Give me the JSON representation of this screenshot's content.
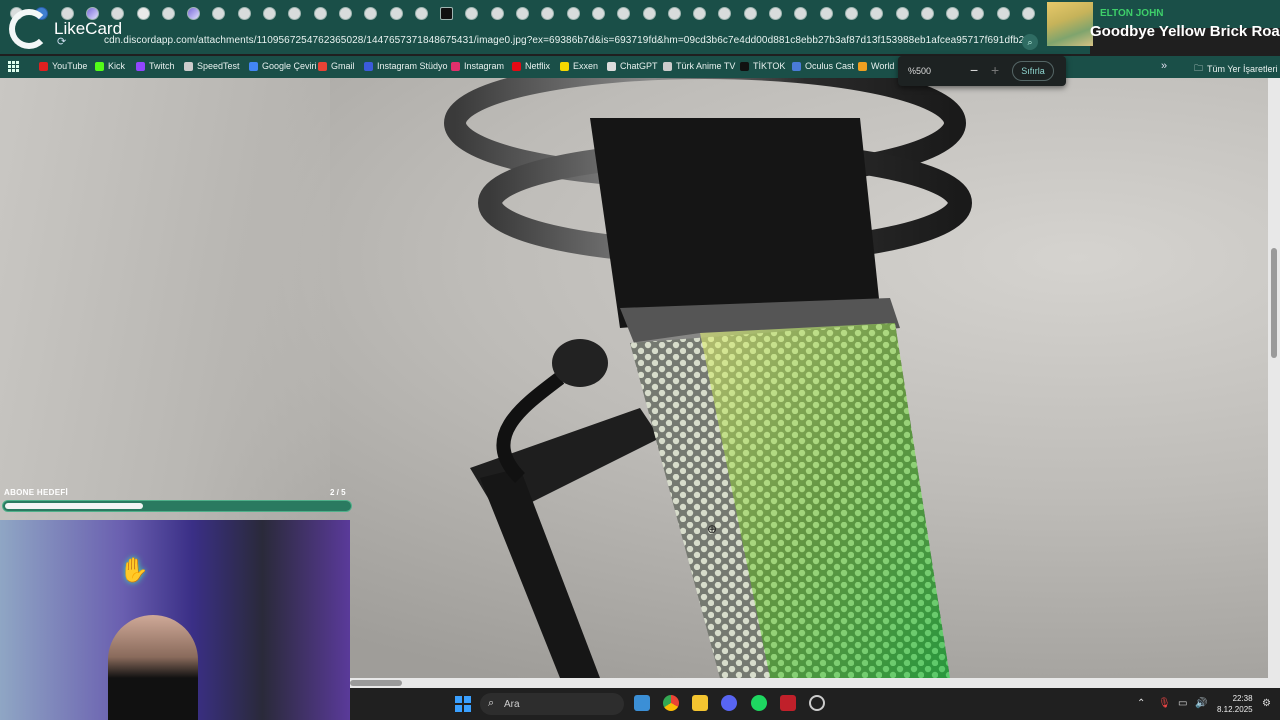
{
  "browser": {
    "url": "cdn.discordapp.com/attachments/1109567254762365028/1447657371848675431/image0.jpg?ex=69386b7d&is=693719fd&hm=09cd3b6c7e4dd00d881c8ebb27b3af87d13f153988eb1afcea95717f691dfb2&",
    "zoom_value": "%500",
    "zoom_reset": "Sıfırla",
    "all_bookmarks": "Tüm Yer İşaretleri",
    "bookmarks": [
      {
        "label": "YouTube",
        "color": "#e02020"
      },
      {
        "label": "Kick",
        "color": "#53fc18"
      },
      {
        "label": "Twitch",
        "color": "#9146ff"
      },
      {
        "label": "SpeedTest",
        "color": "#cccccc"
      },
      {
        "label": "Google Çeviri",
        "color": "#4285f4"
      },
      {
        "label": "Gmail",
        "color": "#ea4335"
      },
      {
        "label": "Instagram Stüdyo",
        "color": "#3b5bdb"
      },
      {
        "label": "Instagram",
        "color": "#e1306c"
      },
      {
        "label": "Netflix",
        "color": "#e50914"
      },
      {
        "label": "Exxen",
        "color": "#f5d800"
      },
      {
        "label": "ChatGPT",
        "color": "#dddddd"
      },
      {
        "label": "Türk Anime TV",
        "color": "#cccccc"
      },
      {
        "label": "TİKTOK",
        "color": "#111111"
      },
      {
        "label": "Oculus Cast",
        "color": "#4a7bd8"
      },
      {
        "label": "World",
        "color": "#f0a020"
      }
    ]
  },
  "overlay": {
    "logo_text": "LikeCard",
    "now_playing_artist": "ELTON JOHN",
    "now_playing_title": "Goodbye Yellow Brick Road",
    "sub_goal_label": "ABONE HEDEFİ",
    "sub_goal_count": "2 / 5",
    "sub_goal_fraction": 0.4
  },
  "taskbar": {
    "search_placeholder": "Ara",
    "time": "22:38",
    "date": "8.12.2025"
  }
}
